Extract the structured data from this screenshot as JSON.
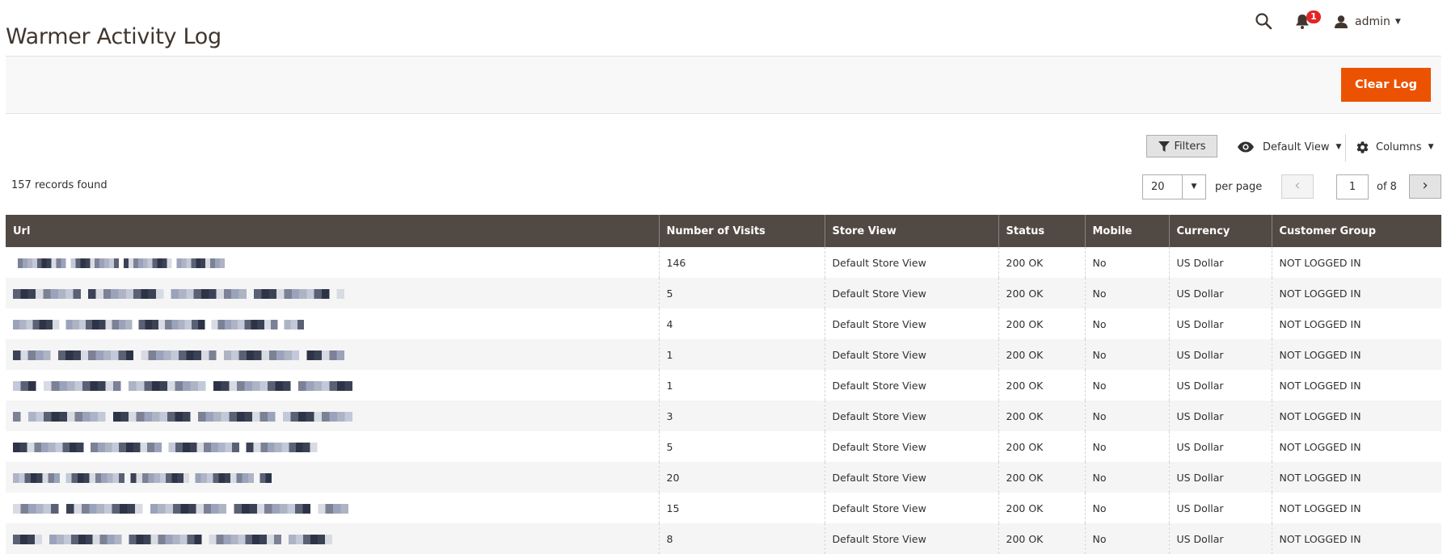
{
  "page": {
    "title": "Warmer Activity Log"
  },
  "header": {
    "search_icon": "search-icon",
    "notifications_count": "1",
    "user_name": "admin"
  },
  "action_bar": {
    "clear_log_label": "Clear Log"
  },
  "toolbar": {
    "filters_label": "Filters",
    "view_label": "Default View",
    "columns_label": "Columns"
  },
  "pagination": {
    "records_found": "157 records found",
    "per_page_value": "20",
    "per_page_label": "per page",
    "current_page": "1",
    "of_pages": "of 8"
  },
  "colors": {
    "accent": "#eb5202",
    "header_bg": "#514943",
    "badge": "#e22626"
  },
  "table": {
    "columns": [
      "Url",
      "Number of Visits",
      "Store View",
      "Status",
      "Mobile",
      "Currency",
      "Customer Group"
    ],
    "rows": [
      {
        "url": "",
        "visits": "146",
        "store_view": "Default Store View",
        "status": "200 OK",
        "mobile": "No",
        "currency": "US Dollar",
        "group": "NOT LOGGED IN"
      },
      {
        "url": "",
        "visits": "5",
        "store_view": "Default Store View",
        "status": "200 OK",
        "mobile": "No",
        "currency": "US Dollar",
        "group": "NOT LOGGED IN"
      },
      {
        "url": "",
        "visits": "4",
        "store_view": "Default Store View",
        "status": "200 OK",
        "mobile": "No",
        "currency": "US Dollar",
        "group": "NOT LOGGED IN"
      },
      {
        "url": "",
        "visits": "1",
        "store_view": "Default Store View",
        "status": "200 OK",
        "mobile": "No",
        "currency": "US Dollar",
        "group": "NOT LOGGED IN"
      },
      {
        "url": "",
        "visits": "1",
        "store_view": "Default Store View",
        "status": "200 OK",
        "mobile": "No",
        "currency": "US Dollar",
        "group": "NOT LOGGED IN"
      },
      {
        "url": "",
        "visits": "3",
        "store_view": "Default Store View",
        "status": "200 OK",
        "mobile": "No",
        "currency": "US Dollar",
        "group": "NOT LOGGED IN"
      },
      {
        "url": "",
        "visits": "5",
        "store_view": "Default Store View",
        "status": "200 OK",
        "mobile": "No",
        "currency": "US Dollar",
        "group": "NOT LOGGED IN"
      },
      {
        "url": "",
        "visits": "20",
        "store_view": "Default Store View",
        "status": "200 OK",
        "mobile": "No",
        "currency": "US Dollar",
        "group": "NOT LOGGED IN"
      },
      {
        "url": "",
        "visits": "15",
        "store_view": "Default Store View",
        "status": "200 OK",
        "mobile": "No",
        "currency": "US Dollar",
        "group": "NOT LOGGED IN"
      },
      {
        "url": "",
        "visits": "8",
        "store_view": "Default Store View",
        "status": "200 OK",
        "mobile": "No",
        "currency": "US Dollar",
        "group": "NOT LOGGED IN"
      }
    ]
  }
}
